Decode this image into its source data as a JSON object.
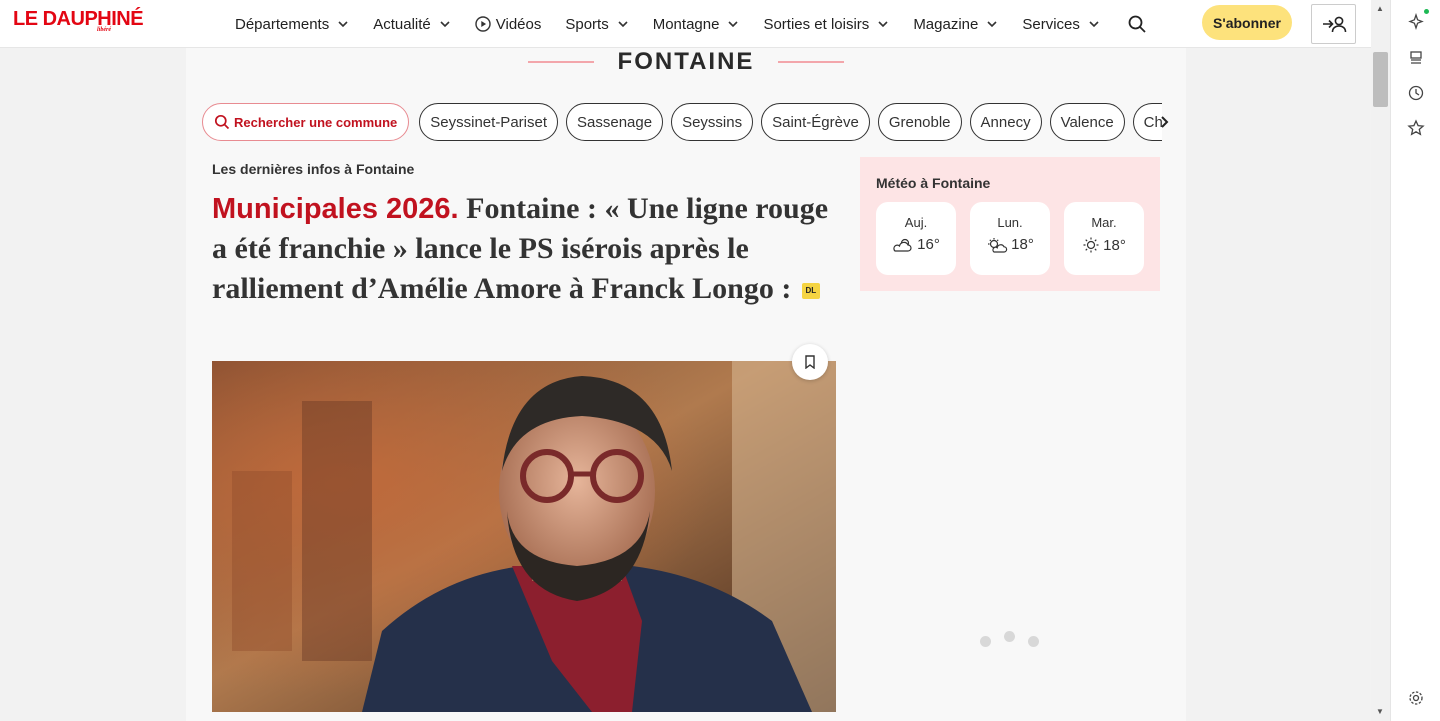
{
  "header": {
    "logo": "LE DAUPHINÉ",
    "logo_sub": "libéré",
    "nav": [
      {
        "label": "Départements",
        "chevron": true
      },
      {
        "label": "Actualité",
        "chevron": true
      },
      {
        "label": "Vidéos",
        "chevron": false
      },
      {
        "label": "Sports",
        "chevron": true
      },
      {
        "label": "Montagne",
        "chevron": true
      },
      {
        "label": "Sorties et loisirs",
        "chevron": true
      },
      {
        "label": "Magazine",
        "chevron": true
      },
      {
        "label": "Services",
        "chevron": true
      }
    ],
    "subscribe_label": "S'abonner"
  },
  "section": {
    "title": "FONTAINE"
  },
  "chips": {
    "search_label": "Rechercher une commune",
    "communes": [
      "Seyssinet-Pariset",
      "Sassenage",
      "Seyssins",
      "Saint-Égrève",
      "Grenoble",
      "Annecy",
      "Valence"
    ],
    "clipped": "Char"
  },
  "article": {
    "latest_label": "Les dernières infos à Fontaine",
    "kicker": "Municipales 2026.",
    "title": " Fontaine : « Une ligne rouge a été franchie » lance le PS isérois après le ralliement d’Amélie Amore à Franck Longo :",
    "badge": "DL"
  },
  "weather": {
    "title": "Météo à Fontaine",
    "days": [
      {
        "day": "Auj.",
        "temp": "16°",
        "icon": "cloud-sun-icon"
      },
      {
        "day": "Lun.",
        "temp": "18°",
        "icon": "sun-behind-cloud-icon"
      },
      {
        "day": "Mar.",
        "temp": "18°",
        "icon": "sun-icon"
      }
    ]
  },
  "colors": {
    "brand_red": "#e30613",
    "kicker_red": "#c1121f",
    "subscribe_yellow": "#fde27c",
    "weather_bg": "#fde4e5"
  }
}
